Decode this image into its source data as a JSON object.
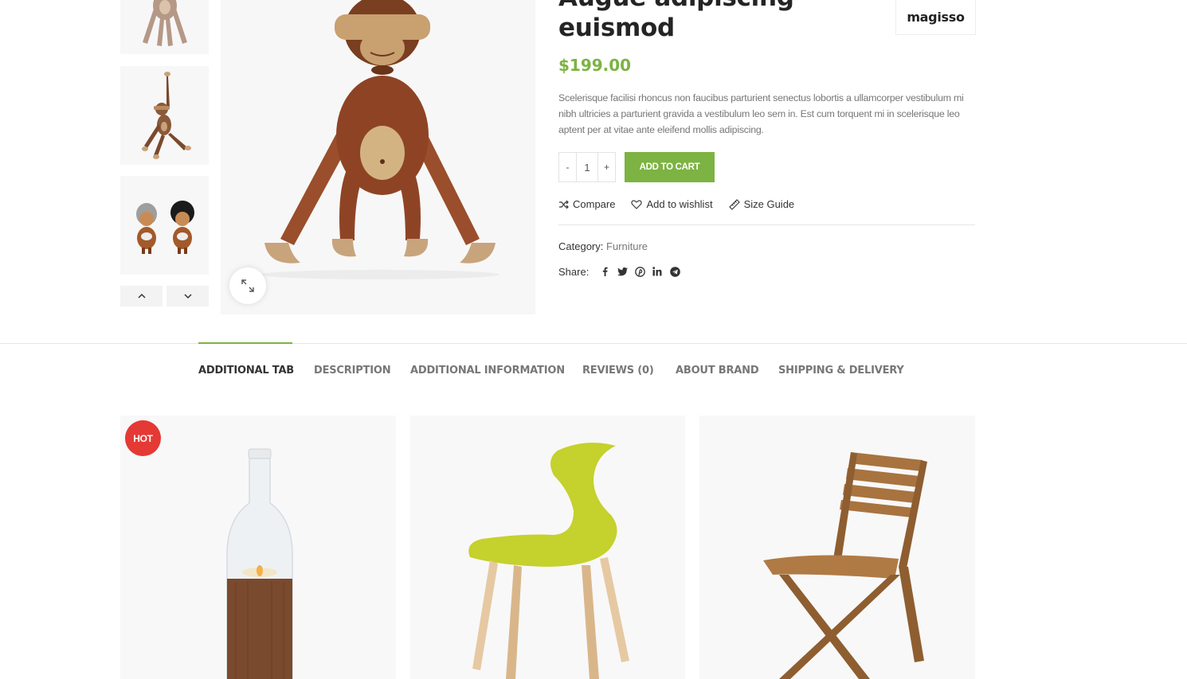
{
  "product": {
    "title": "Augue adipiscing euismod",
    "brand": "magisso",
    "price": "$199.00",
    "description": "Scelerisque facilisi rhoncus non faucibus parturient senectus lobortis a ullamcorper vestibulum mi nibh ultricies a parturient gravida a vestibulum leo sem in. Est cum torquent mi in scelerisque leo aptent per at vitae ante eleifend mollis adipiscing.",
    "quantity": "1",
    "qty_minus": "-",
    "qty_plus": "+",
    "add_to_cart": "ADD TO CART",
    "category_label": "Category:",
    "category_value": "Furniture",
    "share_label": "Share:"
  },
  "actions": {
    "compare": "Compare",
    "wishlist": "Add to wishlist",
    "size_guide": "Size Guide"
  },
  "share_icons": [
    "facebook-icon",
    "twitter-icon",
    "pinterest-icon",
    "linkedin-icon",
    "telegram-icon"
  ],
  "tabs": [
    {
      "label": "ADDITIONAL TAB",
      "active": true
    },
    {
      "label": "DESCRIPTION",
      "active": false
    },
    {
      "label": "ADDITIONAL INFORMATION",
      "active": false
    },
    {
      "label": "REVIEWS (0)",
      "active": false
    },
    {
      "label": "ABOUT BRAND",
      "active": false
    },
    {
      "label": "SHIPPING & DELIVERY",
      "active": false
    }
  ],
  "related": {
    "badge": "HOT"
  },
  "colors": {
    "accent": "#7cb342",
    "hot_badge": "#e53935",
    "heading": "#242424",
    "muted": "#777777",
    "image_bg": "#f7f7f7"
  }
}
